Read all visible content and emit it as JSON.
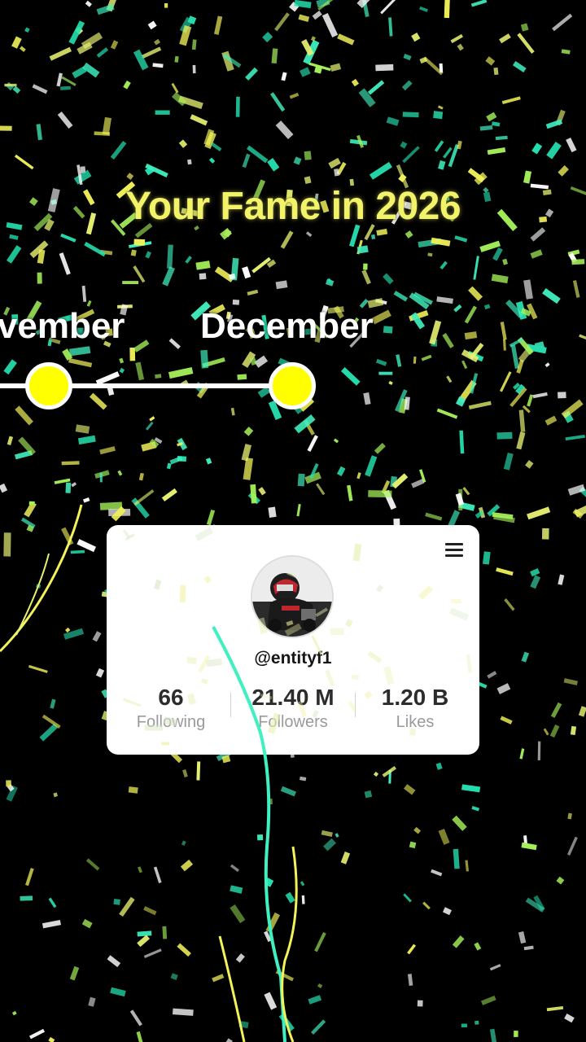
{
  "header": {
    "title": "Your Fame in 2026"
  },
  "timeline": {
    "previous_month": "ovember",
    "current_month": "December"
  },
  "profile_card": {
    "username": "@entityf1",
    "stats": [
      {
        "value": "66",
        "label": "Following"
      },
      {
        "value": "21.40 M",
        "label": "Followers"
      },
      {
        "value": "1.20 B",
        "label": "Likes"
      }
    ]
  },
  "icons": {
    "menu": "hamburger-menu-icon",
    "avatar": "profile-avatar"
  },
  "colors": {
    "background": "#000000",
    "title": "#f3f36a",
    "timeline_dot": "#ffff00",
    "confetti": [
      "#f2f25a",
      "#3ff0c0",
      "#a6f25a",
      "#ffffff",
      "#e6f070",
      "#25e0b0"
    ]
  }
}
